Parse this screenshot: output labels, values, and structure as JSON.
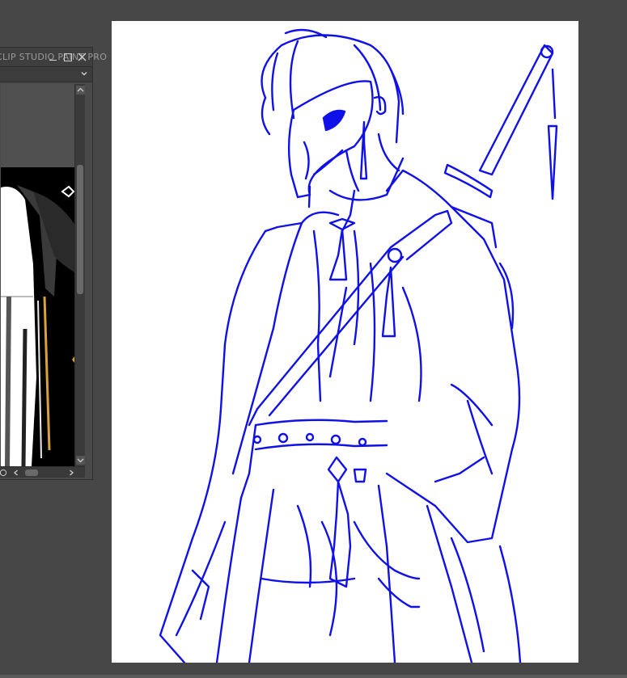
{
  "reference_window": {
    "title": "CLIP STUDIO PAINT PRO",
    "controls": {
      "minimize": "minimize",
      "maximize": "maximize",
      "close": "close"
    },
    "dropdown": {
      "selected": ""
    }
  },
  "canvas": {
    "line_color": "#1010e8",
    "background": "#ffffff",
    "app_background": "#474747"
  },
  "icons": [
    "minimize-icon",
    "maximize-icon",
    "close-icon",
    "chevron-down-icon",
    "scroll-arrow-icon",
    "zoom-icon"
  ]
}
